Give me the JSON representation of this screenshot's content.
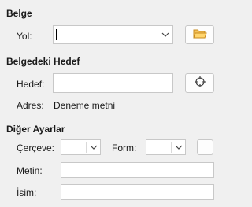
{
  "sections": {
    "document": {
      "heading": "Belge",
      "path_label": "Yol:",
      "path_value": ""
    },
    "target": {
      "heading": "Belgedeki Hedef",
      "target_label": "Hedef:",
      "target_value": "",
      "address_label": "Adres:",
      "address_value": "Deneme metni"
    },
    "other": {
      "heading": "Diğer Ayarlar",
      "frame_label": "Çerçeve:",
      "form_label": "Form:",
      "text_label": "Metin:",
      "name_label": "İsim:"
    }
  },
  "icons": {
    "open_folder": "folder-open-icon",
    "target": "crosshair-icon",
    "dropdown": "chevron-down-icon"
  },
  "colors": {
    "folder": "#e8a33c"
  }
}
